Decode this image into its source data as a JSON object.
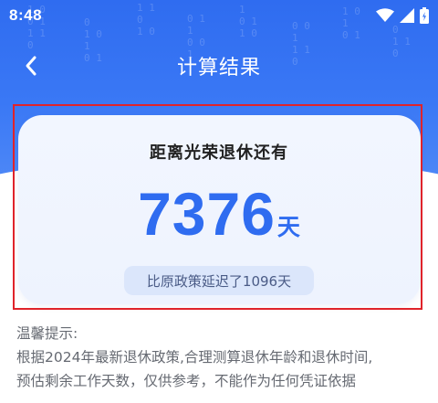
{
  "status_bar": {
    "time": "8:48",
    "icons": [
      "wifi-icon",
      "signal-icon",
      "battery-icon"
    ]
  },
  "header": {
    "title": "计算结果",
    "back_icon": "chevron-left-icon"
  },
  "result_card": {
    "heading": "距离光荣退休还有",
    "days_value": "7376",
    "days_unit": "天",
    "delay_text": "比原政策延迟了1096天"
  },
  "tips": {
    "title": "温馨提示:",
    "lines": [
      "根据2024年最新退休政策,合理测算退休年龄和退休时间,",
      "预估剩余工作天数，仅供参考，不能作为任何凭证依据"
    ]
  },
  "colors": {
    "accent": "#2f6cf0",
    "highlight_border": "#e0232a",
    "card_bg": "#f2f6ff",
    "pill_bg": "#dbe6fb"
  }
}
